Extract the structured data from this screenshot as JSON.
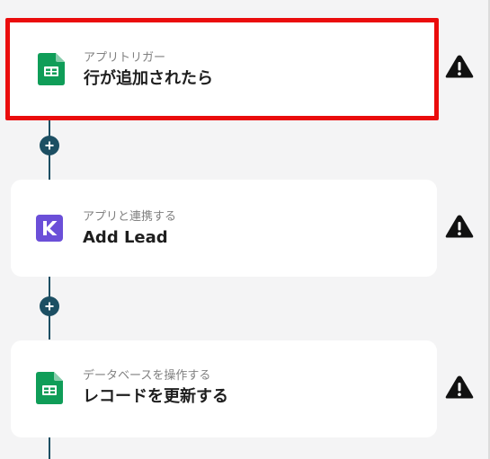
{
  "steps": [
    {
      "subtitle": "アプリトリガー",
      "title": "行が追加されたら",
      "app_icon": "google-sheets-icon",
      "selected": true,
      "warning_icon": "warning-icon"
    },
    {
      "subtitle": "アプリと連携する",
      "title": "Add Lead",
      "app_icon": "kommo-icon",
      "selected": false,
      "warning_icon": "warning-icon"
    },
    {
      "subtitle": "データベースを操作する",
      "title": "レコードを更新する",
      "app_icon": "google-sheets-icon",
      "selected": false,
      "warning_icon": "warning-icon"
    }
  ],
  "add_step_icon": "plus-icon",
  "colors": {
    "connector": "#1c4f63",
    "selection_border": "#ea0c0c",
    "sheets_green": "#0f9d58",
    "kommo_purple": "#6b4fd8",
    "warning": "#111111"
  }
}
